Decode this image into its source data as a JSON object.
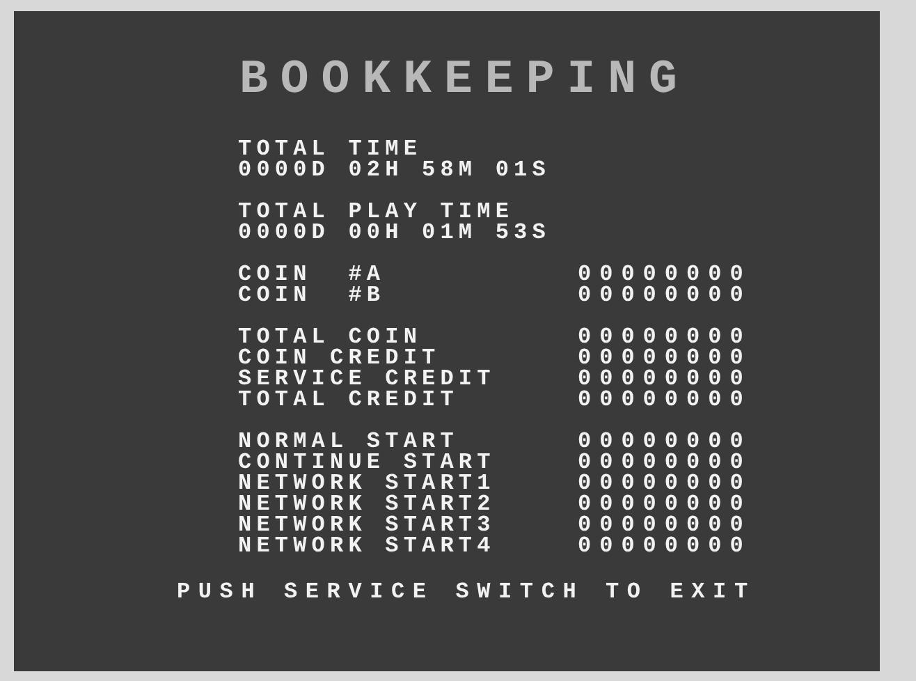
{
  "title": "BOOKKEEPING",
  "time_stats": [
    {
      "label": "TOTAL TIME",
      "value": "0000D 02H 58M 01S"
    },
    {
      "label": "TOTAL PLAY TIME",
      "value": "0000D 00H 01M 53S"
    }
  ],
  "counter_groups": [
    {
      "counters": [
        {
          "label": "COIN  #A",
          "value": "00000000"
        },
        {
          "label": "COIN  #B",
          "value": "00000000"
        }
      ]
    },
    {
      "counters": [
        {
          "label": "TOTAL COIN",
          "value": "00000000"
        },
        {
          "label": "COIN CREDIT",
          "value": "00000000"
        },
        {
          "label": "SERVICE CREDIT",
          "value": "00000000"
        },
        {
          "label": "TOTAL CREDIT",
          "value": "00000000"
        }
      ]
    },
    {
      "counters": [
        {
          "label": "NORMAL START",
          "value": "00000000"
        },
        {
          "label": "CONTINUE START",
          "value": "00000000"
        },
        {
          "label": "NETWORK START1",
          "value": "00000000"
        },
        {
          "label": "NETWORK START2",
          "value": "00000000"
        },
        {
          "label": "NETWORK START3",
          "value": "00000000"
        },
        {
          "label": "NETWORK START4",
          "value": "00000000"
        }
      ]
    }
  ],
  "footer": "PUSH SERVICE SWITCH TO EXIT"
}
